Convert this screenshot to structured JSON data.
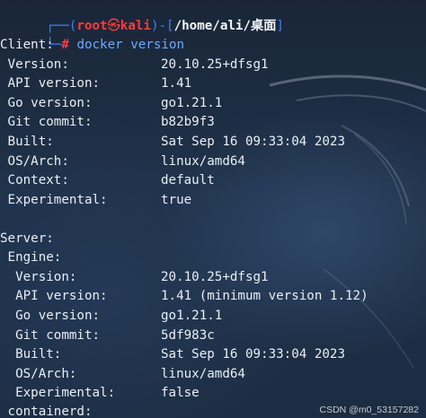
{
  "prompt": {
    "open": "┌──(",
    "user": "root",
    "at_symbol": "㉿",
    "host": "kali",
    "mid": ")-[",
    "path": "/home/ali/桌面",
    "close": "]",
    "second_line_prefix": "└─",
    "hash": "#",
    "command": "docker version"
  },
  "client": {
    "header": "Client:",
    "rows": [
      {
        "key": " Version:",
        "value": "20.10.25+dfsg1"
      },
      {
        "key": " API version:",
        "value": "1.41"
      },
      {
        "key": " Go version:",
        "value": "go1.21.1"
      },
      {
        "key": " Git commit:",
        "value": "b82b9f3"
      },
      {
        "key": " Built:",
        "value": "Sat Sep 16 09:33:04 2023"
      },
      {
        "key": " OS/Arch:",
        "value": "linux/amd64"
      },
      {
        "key": " Context:",
        "value": "default"
      },
      {
        "key": " Experimental:",
        "value": "true"
      }
    ]
  },
  "server": {
    "header": "Server:",
    "engine_header": " Engine:",
    "rows": [
      {
        "key": "  Version:",
        "value": "20.10.25+dfsg1"
      },
      {
        "key": "  API version:",
        "value": "1.41 (minimum version 1.12)"
      },
      {
        "key": "  Go version:",
        "value": "go1.21.1"
      },
      {
        "key": "  Git commit:",
        "value": "5df983c"
      },
      {
        "key": "  Built:",
        "value": "Sat Sep 16 09:33:04 2023"
      },
      {
        "key": "  OS/Arch:",
        "value": "linux/amd64"
      },
      {
        "key": "  Experimental:",
        "value": "false"
      }
    ],
    "containerd_header": " containerd:"
  },
  "watermark": "CSDN @m0_53157282",
  "colors": {
    "background": "#1b2a3d",
    "prompt_frame": "#3b82f6",
    "prompt_user": "#ff3b3b",
    "command": "#6ea8ff",
    "text": "#e9eef4"
  }
}
